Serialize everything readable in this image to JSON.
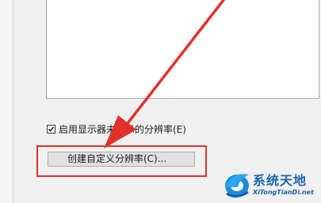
{
  "dialog": {
    "checkbox_label": "启用显示器未显示的分辨率(E)",
    "checkbox_checked": true,
    "create_button_label": "创建自定义分辨率(C)..."
  },
  "annotation": {
    "highlight_color": "#e0322b"
  },
  "watermark": {
    "title": "系统天地",
    "subtitle": "XiTongTianDi.net",
    "color": "#1566b0"
  }
}
